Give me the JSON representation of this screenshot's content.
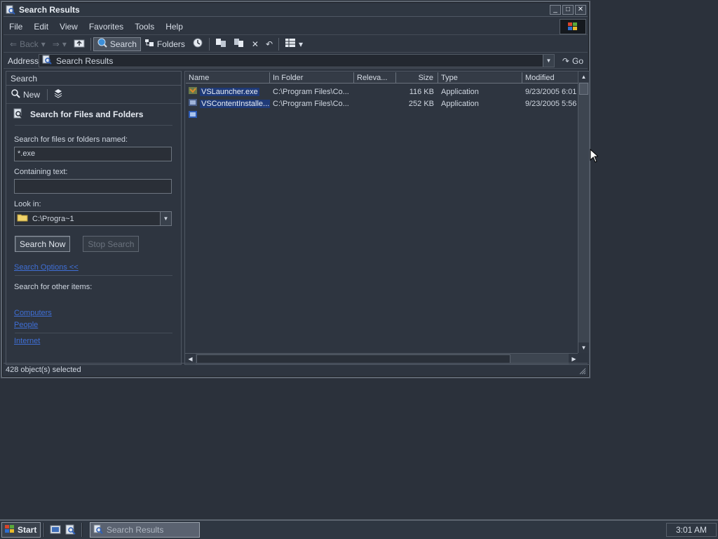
{
  "window": {
    "title": "Search Results",
    "buttons": {
      "minimize": "_",
      "maximize": "□",
      "close": "✕"
    }
  },
  "menu": [
    "File",
    "Edit",
    "View",
    "Favorites",
    "Tools",
    "Help"
  ],
  "toolbar": {
    "back": "Back",
    "search": "Search",
    "folders": "Folders"
  },
  "address": {
    "label": "Address",
    "value": "Search Results",
    "go": "Go"
  },
  "search_pane": {
    "header": "Search",
    "new_label": "New",
    "title": "Search for Files and Folders",
    "named_label": "Search for files or folders named:",
    "named_value": "*.exe",
    "containing_label": "Containing text:",
    "containing_value": "",
    "lookin_label": "Look in:",
    "lookin_value": "C:\\Progra~1",
    "search_now": "Search Now",
    "stop_search": "Stop Search",
    "options_link": "Search Options <<",
    "other_label": "Search for other items:",
    "links": [
      "Computers",
      "People",
      "Internet"
    ]
  },
  "results": {
    "columns": [
      "Name",
      "In Folder",
      "Releva...",
      "Size",
      "Type",
      "Modified"
    ],
    "rows": [
      {
        "name": "VSLauncher.exe",
        "folder": "C:\\Program Files\\Co...",
        "relevance": "",
        "size": "116 KB",
        "type": "Application",
        "modified": "9/23/2005 6:01"
      },
      {
        "name": "VSContentInstalle...",
        "folder": "C:\\Program Files\\Co...",
        "relevance": "",
        "size": "252 KB",
        "type": "Application",
        "modified": "9/23/2005 5:56"
      }
    ]
  },
  "status": "428 object(s) selected",
  "taskbar": {
    "start": "Start",
    "task": "Search Results",
    "clock": "3:01 AM"
  }
}
